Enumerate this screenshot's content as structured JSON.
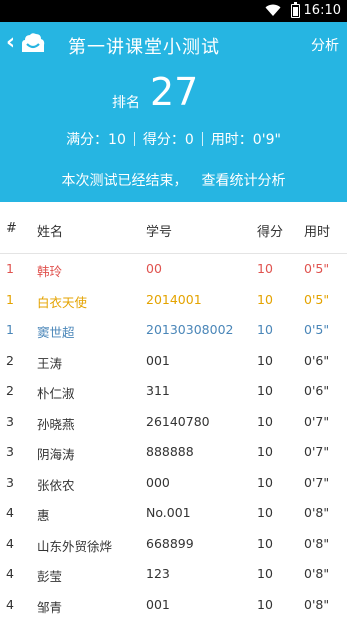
{
  "status_bar": {
    "time": "16:10"
  },
  "header": {
    "title": "第一讲课堂小测试",
    "analyze_label": "分析",
    "rank_label": "排名",
    "rank_value": "27",
    "stats": {
      "full_score": "满分：10",
      "score": "得分：0",
      "time_used": "用时：0'9\""
    },
    "ended_text": "本次测试已经结束，",
    "stats_link": "查看统计分析"
  },
  "table": {
    "columns": [
      "#",
      "姓名",
      "学号",
      "得分",
      "用时"
    ],
    "rows": [
      {
        "rank": "1",
        "name": "韩玲",
        "id": "00",
        "score": "10",
        "time": "0'5\""
      },
      {
        "rank": "1",
        "name": "白衣天使",
        "id": "2014001",
        "score": "10",
        "time": "0'5\""
      },
      {
        "rank": "1",
        "name": "窦世超",
        "id": "20130308002",
        "score": "10",
        "time": "0'5\""
      },
      {
        "rank": "2",
        "name": "王涛",
        "id": "001",
        "score": "10",
        "time": "0'6\""
      },
      {
        "rank": "2",
        "name": "朴仁淑",
        "id": "311",
        "score": "10",
        "time": "0'6\""
      },
      {
        "rank": "3",
        "name": "孙晓燕",
        "id": "26140780",
        "score": "10",
        "time": "0'7\""
      },
      {
        "rank": "3",
        "name": "阴海涛",
        "id": "888888",
        "score": "10",
        "time": "0'7\""
      },
      {
        "rank": "3",
        "name": "张依农",
        "id": "000",
        "score": "10",
        "time": "0'7\""
      },
      {
        "rank": "4",
        "name": "惠",
        "id": "No.001",
        "score": "10",
        "time": "0'8\""
      },
      {
        "rank": "4",
        "name": "山东外贸徐烨",
        "id": "668899",
        "score": "10",
        "time": "0'8\""
      },
      {
        "rank": "4",
        "name": "彭莹",
        "id": "123",
        "score": "10",
        "time": "0'8\""
      },
      {
        "rank": "4",
        "name": "邹青",
        "id": "001",
        "score": "10",
        "time": "0'8\""
      }
    ]
  },
  "colors": {
    "header_bg": "#26b5e2",
    "rank1_first": "#e0534f",
    "rank1_second": "#e4a300",
    "rank1_third": "#4a86b8"
  },
  "icons": [
    "wifi-icon",
    "battery-icon",
    "back-chevron-icon",
    "app-logo-icon"
  ]
}
